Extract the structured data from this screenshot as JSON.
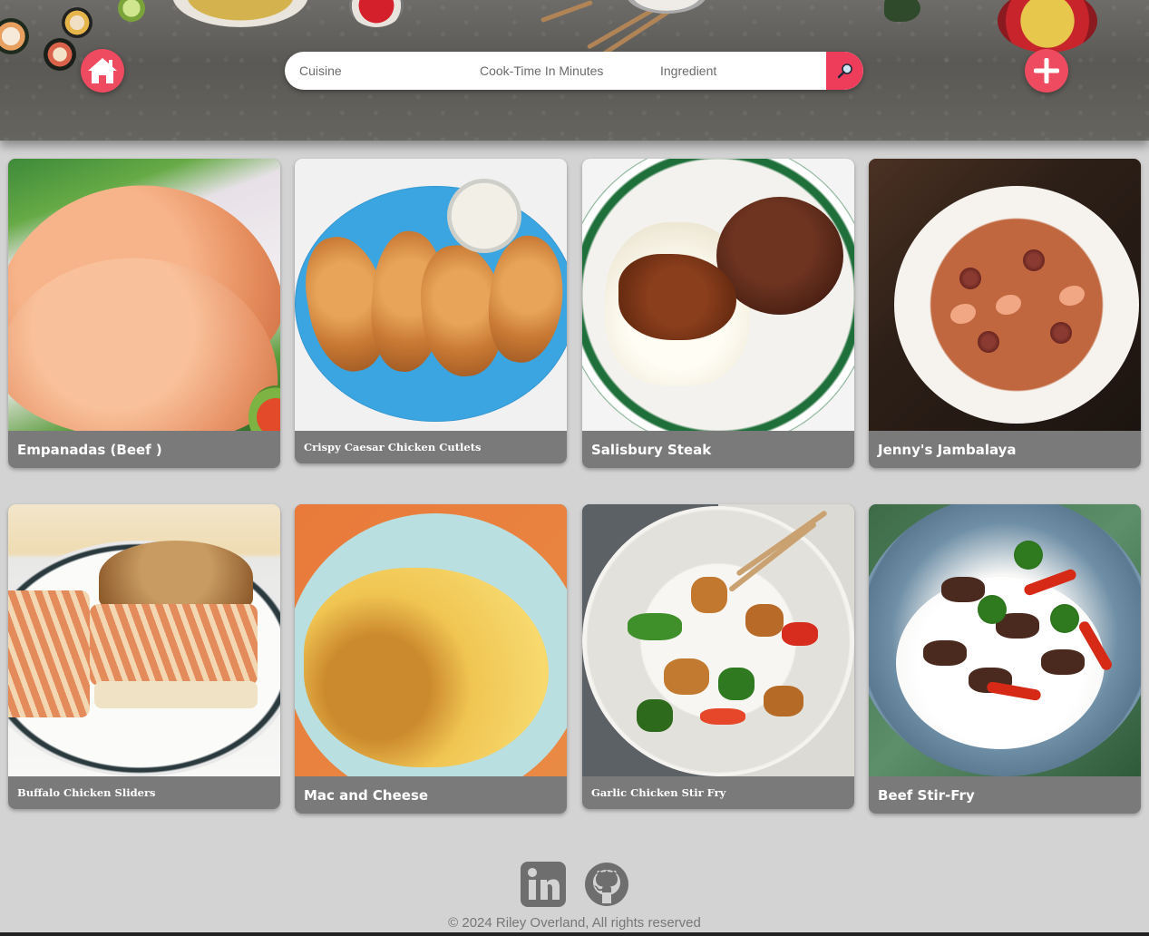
{
  "header": {
    "home_icon": "home-icon",
    "add_icon": "plus-icon",
    "search": {
      "cuisine_placeholder": "Cuisine",
      "cook_time_placeholder": "Cook-Time In Minutes",
      "ingredient_placeholder": "Ingredient",
      "button_icon": "search-icon"
    },
    "accent_color": "#ee4b61"
  },
  "recipes": [
    {
      "title": "Empanadas (Beef )"
    },
    {
      "title": "Crispy Caesar Chicken Cutlets"
    },
    {
      "title": "Salisbury Steak"
    },
    {
      "title": "Jenny's Jambalaya"
    },
    {
      "title": "Buffalo Chicken Sliders"
    },
    {
      "title": "Mac and Cheese"
    },
    {
      "title": "Garlic Chicken Stir Fry"
    },
    {
      "title": "Beef Stir-Fry"
    }
  ],
  "footer": {
    "social": [
      "linkedin-icon",
      "github-icon"
    ],
    "copyright": "© 2024 Riley Overland, All rights reserved"
  }
}
